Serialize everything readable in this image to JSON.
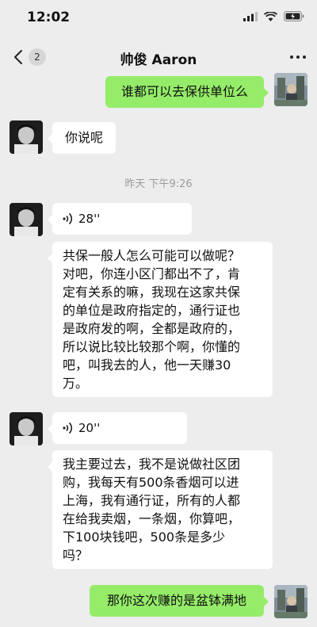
{
  "status_bar": {
    "time": "12:02"
  },
  "nav": {
    "unread_count": "2",
    "title": "帅俊 Aaron"
  },
  "timestamp": "昨天 下午9:26",
  "messages": [
    {
      "from": "me",
      "type": "text",
      "text": "谁都可以去保供单位么"
    },
    {
      "from": "contact",
      "type": "text",
      "text": "你说呢"
    },
    {
      "from": "contact",
      "type": "voice",
      "duration": "28''"
    },
    {
      "from": "contact",
      "type": "text",
      "lines": [
        "共保一般人怎么可能可以做呢？",
        "对吧，你连小区门都出不了，肯",
        "定有关系的嘛，我现在这家共保",
        "的单位是政府指定的，通行证也",
        "是政府发的啊，全都是政府的，",
        "所以说比较比较那个啊，你懂的",
        "吧，叫我去的人，他一天赚30",
        "万。"
      ]
    },
    {
      "from": "contact",
      "type": "voice",
      "duration": "20''"
    },
    {
      "from": "contact",
      "type": "text",
      "lines": [
        "我主要过去，我不是说做社区团",
        "购，我每天有500条香烟可以进",
        "上海，我有通行证，所有的人都",
        "在给我卖烟，一条烟，你算吧，",
        "下100块钱吧，500条是多少",
        "吗？"
      ]
    },
    {
      "from": "me",
      "type": "text",
      "text": "那你这次赚的是盆钵满地"
    }
  ],
  "colors": {
    "background": "#ededed",
    "bubble_in": "#ffffff",
    "bubble_out": "#95ec69"
  }
}
